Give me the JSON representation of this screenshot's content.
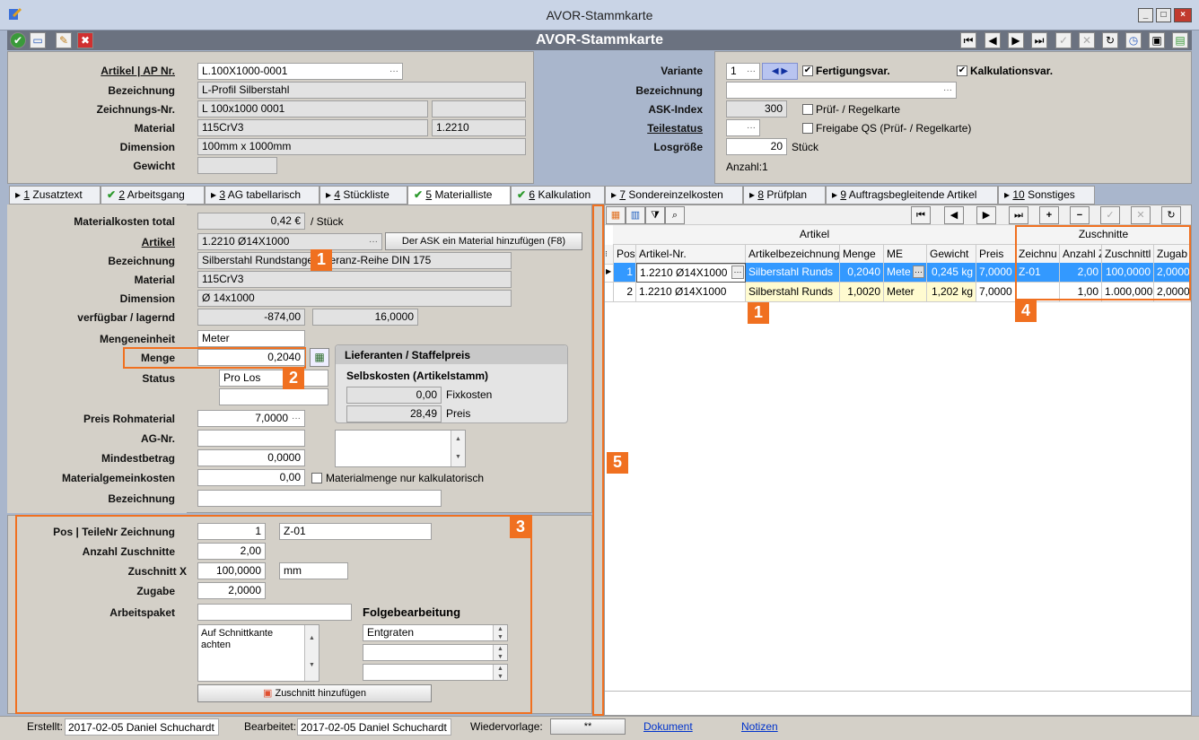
{
  "window": {
    "title": "AVOR-Stammkarte",
    "toolbar_title": "AVOR-Stammkarte"
  },
  "header": {
    "artikel_label": "Artikel | AP Nr.",
    "artikel_value": "L.100X1000-0001",
    "bezeichnung_label": "Bezeichnung",
    "bezeichnung_value": "L-Profil Silberstahl",
    "zeichnung_label": "Zeichnungs-Nr.",
    "zeichnung_value": "L 100x1000 0001",
    "material_label": "Material",
    "material_value": "115CrV3",
    "material_no": "1.2210",
    "dimension_label": "Dimension",
    "dimension_value": "100mm x 1000mm",
    "gewicht_label": "Gewicht",
    "variante_label": "Variante",
    "variante_value": "1",
    "fertigungsvar": "Fertigungsvar.",
    "kalkulationsvar": "Kalkulationsvar.",
    "bez2_label": "Bezeichnung",
    "ask_label": "ASK-Index",
    "ask_value": "300",
    "pruef": "Prüf- / Regelkarte",
    "teilestatus_label": "Teilestatus",
    "freigabe": "Freigabe QS (Prüf- / Regelkarte)",
    "losgroesse_label": "Losgröße",
    "losgroesse_value": "20",
    "stueck": "Stück",
    "anzahl": "Anzahl:1"
  },
  "tabs": [
    {
      "num": "1",
      "label": "Zusatztext",
      "check": false
    },
    {
      "num": "2",
      "label": "Arbeitsgang",
      "check": true
    },
    {
      "num": "3",
      "label": "AG tabellarisch",
      "check": false
    },
    {
      "num": "4",
      "label": "Stückliste",
      "check": false
    },
    {
      "num": "5",
      "label": "Materialliste",
      "check": true
    },
    {
      "num": "6",
      "label": "Kalkulation",
      "check": true
    },
    {
      "num": "7",
      "label": "Sondereinzelkosten",
      "check": false
    },
    {
      "num": "8",
      "label": "Prüfplan",
      "check": false
    },
    {
      "num": "9",
      "label": "Auftragsbegleitende Artikel",
      "check": false
    },
    {
      "num": "10",
      "label": "Sonstiges",
      "check": false
    }
  ],
  "material": {
    "kosten_label": "Materialkosten total",
    "kosten_value": "0,42 €",
    "per_stueck": "/ Stück",
    "artikel_label": "Artikel",
    "artikel_value": "1.2210 Ø14X1000",
    "ask_button": "Der ASK ein Material hinzufügen (F8)",
    "bez_label": "Bezeichnung",
    "bez_value": "Silberstahl Rundstange Toleranz-Reihe DIN 175",
    "mat_label": "Material",
    "mat_value": "115CrV3",
    "dim_label": "Dimension",
    "dim_value": "Ø 14x1000",
    "verf_label": "verfügbar / lagernd",
    "verf_value": "-874,00",
    "lager_value": "16,0000",
    "einheit_label": "Mengeneinheit",
    "einheit_value": "Meter",
    "menge_label": "Menge",
    "menge_value": "0,2040",
    "status_label": "Status",
    "status_value": "Pro Los",
    "preis_label": "Preis Rohmaterial",
    "preis_value": "7,0000",
    "ag_label": "AG-Nr.",
    "mindest_label": "Mindestbetrag",
    "mindest_value": "0,0000",
    "gemein_label": "Materialgemeinkosten",
    "gemein_value": "0,00",
    "nur_kalk": "Materialmenge nur kalkulatorisch",
    "bez2_label": "Bezeichnung",
    "lieferanten_title": "Lieferanten / Staffelpreis",
    "selbstkosten": "Selbskosten (Artikelstamm)",
    "fix_value": "0,00",
    "fix_label": "Fixkosten",
    "preis2_value": "28,49",
    "preis2_label": "Preis"
  },
  "zuschnitt": {
    "pos_label": "Pos | TeileNr Zeichnung",
    "pos_value": "1",
    "zeichnung_value": "Z-01",
    "anzahl_label": "Anzahl Zuschnitte",
    "anzahl_value": "2,00",
    "x_label": "Zuschnitt X",
    "x_value": "100,0000",
    "x_unit": "mm",
    "zugabe_label": "Zugabe",
    "zugabe_value": "2,0000",
    "paket_label": "Arbeitspaket",
    "folge_label": "Folgebearbeitung",
    "folge_value": "Entgraten",
    "memo": "Auf Schnittkante achten",
    "add_button": "Zuschnitt hinzufügen"
  },
  "grid": {
    "group_artikel": "Artikel",
    "group_zuschnitte": "Zuschnitte",
    "columns": [
      "Pos",
      "Artikel-Nr.",
      "Artikelbezeichnung",
      "Menge",
      "ME",
      "Gewicht",
      "Preis",
      "Zeichnu",
      "Anzahl Z",
      "Zuschnittl",
      "Zugab"
    ],
    "rows": [
      [
        "1",
        "1.2210 Ø14X1000",
        "Silberstahl Runds",
        "0,2040",
        "Mete",
        "0,245 kg",
        "7,0000",
        "Z-01",
        "2,00",
        "100,0000",
        "2,0000"
      ],
      [
        "2",
        "1.2210 Ø14X1000",
        "Silberstahl Runds",
        "1,0020",
        "Meter",
        "1,202 kg",
        "7,0000",
        "",
        "1,00",
        "1.000,000",
        "2,0000"
      ]
    ]
  },
  "callouts": [
    "1",
    "2",
    "3",
    "4",
    "5",
    "1"
  ],
  "status": {
    "erstellt_label": "Erstellt:",
    "erstellt_value": "2017-02-05  Daniel Schuchardt",
    "bearbeitet_label": "Bearbeitet:",
    "bearbeitet_value": "2017-02-05  Daniel Schuchardt",
    "wieder_label": "Wiedervorlage:",
    "wieder_value": "**",
    "dokument": "Dokument",
    "notizen": "Notizen"
  }
}
